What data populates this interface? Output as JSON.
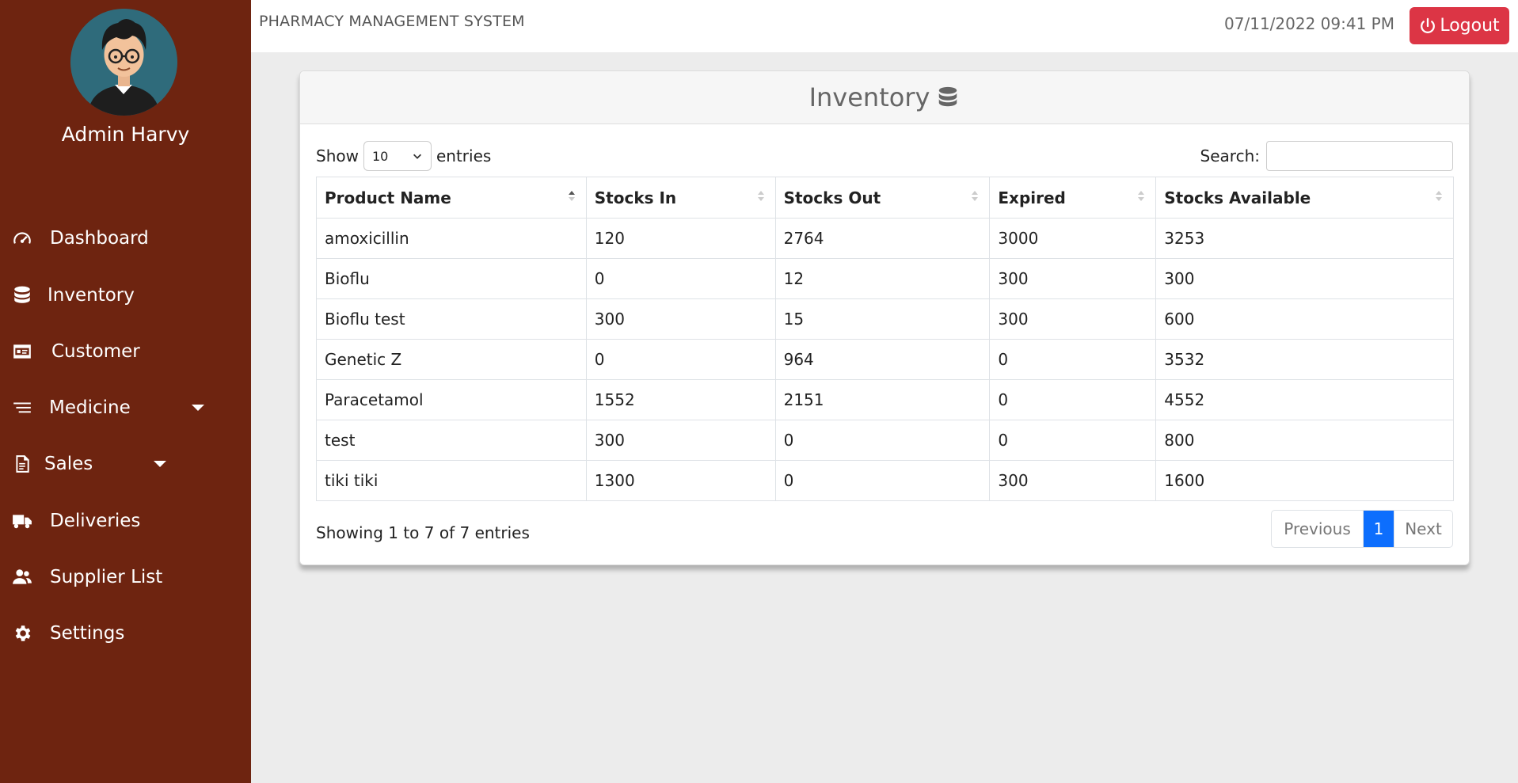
{
  "sidebar": {
    "user_name": "Admin Harvy",
    "items": [
      {
        "label": "Dashboard",
        "icon": "dashboard-gauge-icon"
      },
      {
        "label": "Inventory",
        "icon": "database-icon"
      },
      {
        "label": "Customer",
        "icon": "id-card-icon"
      },
      {
        "label": "Medicine",
        "icon": "list-icon",
        "has_dropdown": true
      },
      {
        "label": "Sales",
        "icon": "document-icon",
        "has_dropdown": true
      },
      {
        "label": "Deliveries",
        "icon": "truck-icon"
      },
      {
        "label": "Supplier List",
        "icon": "users-icon"
      },
      {
        "label": "Settings",
        "icon": "gear-icon"
      }
    ]
  },
  "header": {
    "system_title": "PHARMACY MANAGEMENT SYSTEM",
    "datetime": "07/11/2022 09:41 PM",
    "logout_label": "Logout"
  },
  "card": {
    "title": "Inventory",
    "show_label": "Show",
    "entries_value": "10",
    "entries_label": "entries",
    "search_label": "Search:",
    "search_value": ""
  },
  "table": {
    "columns": [
      "Product Name",
      "Stocks In",
      "Stocks Out",
      "Expired",
      "Stocks Available"
    ],
    "rows": [
      [
        "amoxicillin",
        "120",
        "2764",
        "3000",
        "3253"
      ],
      [
        "Bioflu",
        "0",
        "12",
        "300",
        "300"
      ],
      [
        "Bioflu test",
        "300",
        "15",
        "300",
        "600"
      ],
      [
        "Genetic Z",
        "0",
        "964",
        "0",
        "3532"
      ],
      [
        "Paracetamol",
        "1552",
        "2151",
        "0",
        "4552"
      ],
      [
        "test",
        "300",
        "0",
        "0",
        "800"
      ],
      [
        "tiki tiki",
        "1300",
        "0",
        "300",
        "1600"
      ]
    ]
  },
  "footer": {
    "info": "Showing 1 to 7 of 7 entries",
    "previous_label": "Previous",
    "current_page": "1",
    "next_label": "Next"
  },
  "colors": {
    "sidebar_bg": "#6e2410",
    "logout_bg": "#dc3545",
    "pager_active": "#0d6efd"
  }
}
